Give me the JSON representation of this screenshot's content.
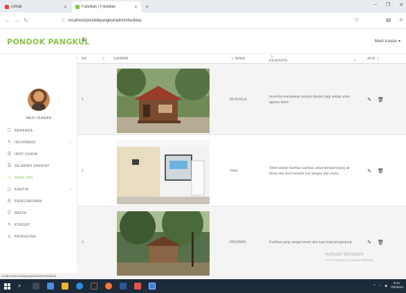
{
  "browser": {
    "tabs": [
      {
        "label": "Gmail",
        "active": false,
        "icon": "gmail-icon",
        "color": "#ea4335"
      },
      {
        "label": "Fasilitas | Fasilitas",
        "active": true,
        "icon": "page-icon",
        "color": "#8bc34a"
      }
    ],
    "url_scheme": "ⓘ",
    "url": "localhost/pondokpangkul/admin/fasilitas"
  },
  "app": {
    "brand": "PONDOK PANGKUL",
    "user_menu": "Medi Irawan ▾"
  },
  "sidebar": {
    "username": "MEDI IRAWAN",
    "items": [
      {
        "label": "BERANDA",
        "icon": "☐",
        "active": false,
        "caret": false
      },
      {
        "label": "INFORMASI",
        "icon": "✎",
        "active": false,
        "caret": true
      },
      {
        "label": "INFO USAHA",
        "icon": "☰",
        "active": false,
        "caret": false
      },
      {
        "label": "SEJARAH SINGKAT",
        "icon": "⎙",
        "active": false,
        "caret": false
      },
      {
        "label": "FASILITAS",
        "icon": "▭",
        "active": true,
        "caret": false
      },
      {
        "label": "KANTIN",
        "icon": "▢",
        "active": false,
        "caret": true
      },
      {
        "label": "PENGUMUMAN",
        "icon": "☰",
        "active": false,
        "caret": false
      },
      {
        "label": "MEDIA",
        "icon": "☷",
        "active": false,
        "caret": false
      },
      {
        "label": "KONSEP",
        "icon": "✎",
        "active": false,
        "caret": false
      },
      {
        "label": "PENGGUNA",
        "icon": "♙",
        "active": false,
        "caret": false
      }
    ],
    "status_url": "localhost/pondokpangkul/admin/fasilitas"
  },
  "table": {
    "headers": {
      "no": "NO",
      "gambar": "GAMBAR",
      "nama": "NAMA",
      "deskripsi": "DESKRIPSI",
      "aksi": "AKSI"
    },
    "rows": [
      {
        "no": "1",
        "nama": "MUSHOLA",
        "deskripsi": "mushola merupakan tempat ibadah bagi setiap umat agama islam",
        "image": "musholla-photo"
      },
      {
        "no": "2",
        "nama": "Toilet",
        "deskripsi": "Toilet adalah fasilitas sanitasi untuk tempat buang air besar dan kecil tempat cuci tangan dan muka",
        "image": "toilet-photo"
      },
      {
        "no": "3",
        "nama": "PASEBAN",
        "deskripsi": "Fasilitas yang sangat aman dan luas bagi pengunjung",
        "image": "paseban-photo"
      }
    ],
    "edit_icon": "✎",
    "delete_icon": "🗑"
  },
  "watermark": {
    "title": "Activate Windows",
    "subtitle": "Go to Settings to activate Windows."
  },
  "taskbar": {
    "time": "9:41",
    "date": "7/5/2023"
  }
}
